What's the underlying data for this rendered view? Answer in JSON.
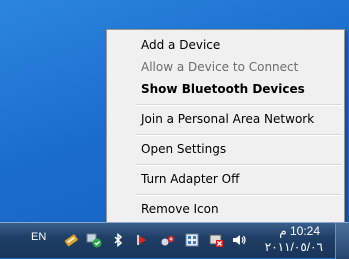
{
  "context_menu": {
    "items": [
      {
        "label": "Add a Device",
        "enabled": true,
        "bold": false
      },
      {
        "label": "Allow a Device to Connect",
        "enabled": false,
        "bold": false
      },
      {
        "label": "Show Bluetooth Devices",
        "enabled": true,
        "bold": true
      },
      {
        "label": "Join a Personal Area Network",
        "enabled": true,
        "bold": false
      },
      {
        "label": "Open Settings",
        "enabled": true,
        "bold": false
      },
      {
        "label": "Turn Adapter Off",
        "enabled": true,
        "bold": false
      },
      {
        "label": "Remove Icon",
        "enabled": true,
        "bold": false
      }
    ]
  },
  "taskbar": {
    "language": "EN",
    "tray_icons": [
      "pen-tablet-icon",
      "network-sync-icon",
      "bluetooth-icon",
      "pdf-icon",
      "network-share-icon",
      "update-shield-icon",
      "battery-monitor-icon",
      "volume-icon"
    ],
    "clock": {
      "time": "10:24 م",
      "date": "٢٠١١/٠٥/٠٦"
    }
  },
  "colors": {
    "desktop": "#1a6fc9",
    "menu_bg": "#f0f0f0",
    "taskbar": "#1f3f66"
  }
}
